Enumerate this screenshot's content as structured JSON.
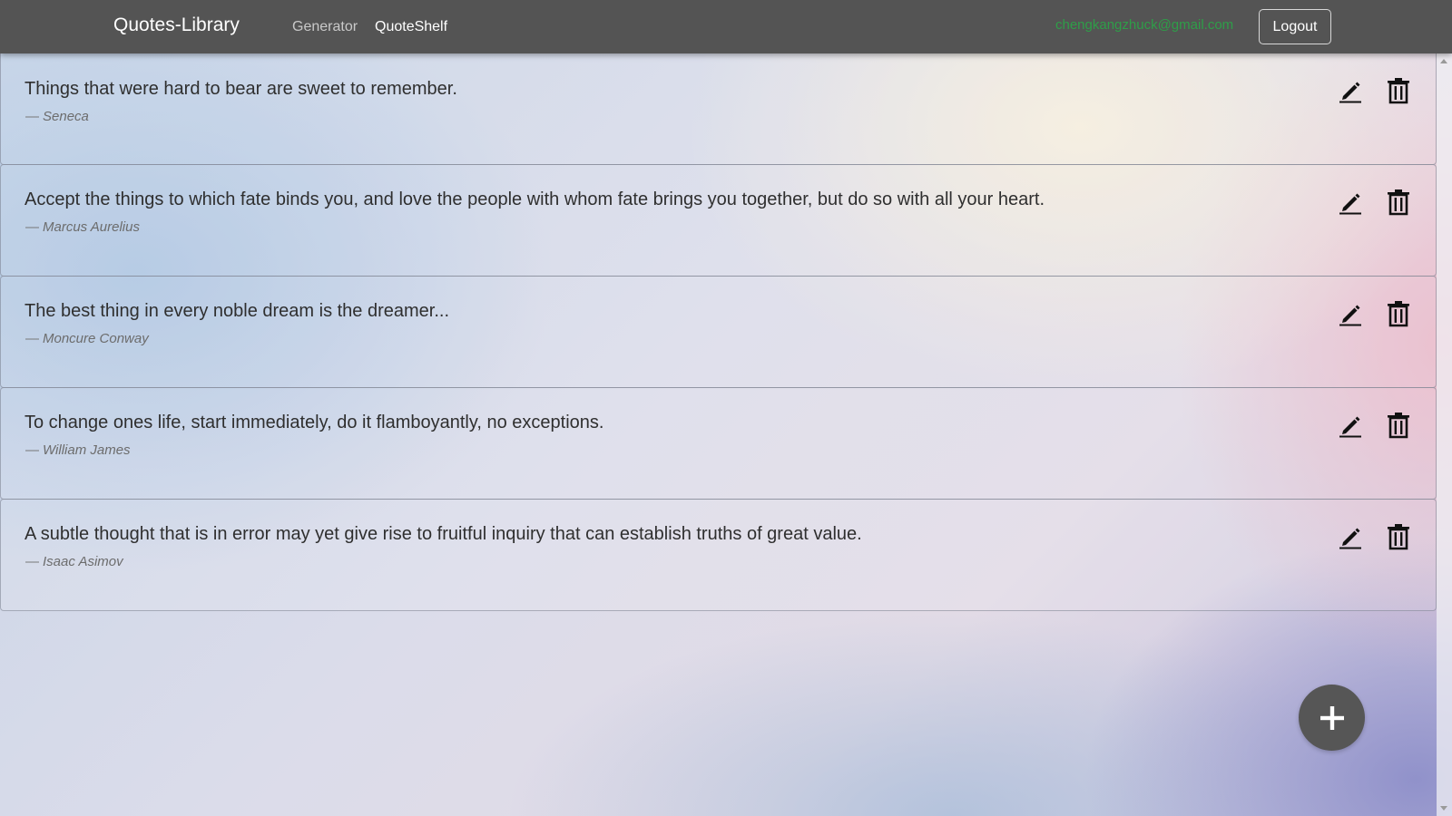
{
  "navbar": {
    "brand": "Quotes-Library",
    "links": [
      {
        "label": "Generator",
        "active": false
      },
      {
        "label": "QuoteShelf",
        "active": true
      }
    ],
    "user_email": "chengkangzhuck@gmail.com",
    "logout_label": "Logout"
  },
  "quotes": [
    {
      "text": "Things that were hard to bear are sweet to remember.",
      "author": "Seneca"
    },
    {
      "text": "Accept the things to which fate binds you, and love the people with whom fate brings you together, but do so with all your heart.",
      "author": "Marcus Aurelius"
    },
    {
      "text": "The best thing in every noble dream is the dreamer...",
      "author": "Moncure Conway"
    },
    {
      "text": "To change ones life, start immediately, do it flamboyantly, no exceptions.",
      "author": "William James"
    },
    {
      "text": "A subtle thought that is in error may yet give rise to fruitful inquiry that can establish truths of great value.",
      "author": "Isaac Asimov"
    }
  ],
  "icons": {
    "edit": "pencil-icon",
    "delete": "trash-icon",
    "add": "plus-icon"
  },
  "colors": {
    "navbar_bg": "#545454",
    "email_text": "#2e9e48",
    "fab_bg": "#565656"
  }
}
